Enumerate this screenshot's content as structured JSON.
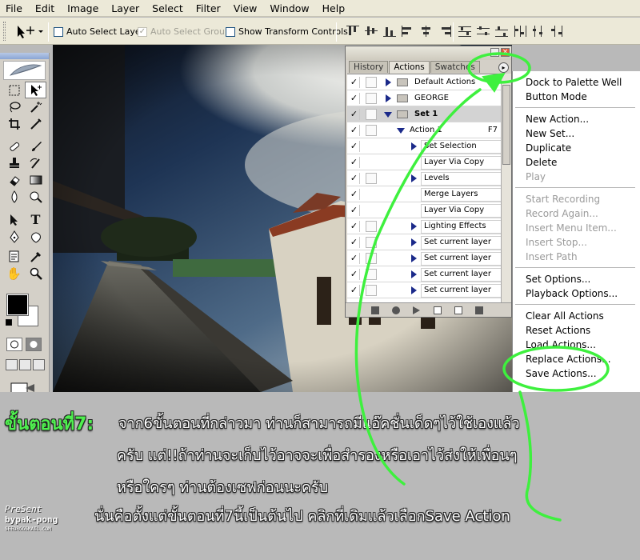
{
  "menubar": [
    "File",
    "Edit",
    "Image",
    "Layer",
    "Select",
    "Filter",
    "View",
    "Window",
    "Help"
  ],
  "options": {
    "auto_select_layer": "Auto Select Layer",
    "auto_select_groups": "Auto Select Groups",
    "show_transform_controls": "Show Transform Controls"
  },
  "palette": {
    "tabs": [
      "History",
      "Actions",
      "Swatches"
    ],
    "active_tab": "Actions",
    "rows": [
      {
        "label": "Default Actions",
        "kind": "set"
      },
      {
        "label": "GEORGE",
        "kind": "set"
      },
      {
        "label": "Set 1",
        "kind": "set-open"
      },
      {
        "label": "Action 1",
        "kind": "action",
        "key": "F7"
      },
      {
        "label": "Set Selection",
        "kind": "cmd"
      },
      {
        "label": "Layer Via Copy",
        "kind": "cmd"
      },
      {
        "label": "Levels",
        "kind": "cmd"
      },
      {
        "label": "Merge Layers",
        "kind": "cmd"
      },
      {
        "label": "Layer Via Copy",
        "kind": "cmd"
      },
      {
        "label": "Lighting Effects",
        "kind": "cmd"
      },
      {
        "label": "Set current layer",
        "kind": "cmd"
      },
      {
        "label": "Set current layer",
        "kind": "cmd"
      },
      {
        "label": "Set current layer",
        "kind": "cmd"
      },
      {
        "label": "Set current layer",
        "kind": "cmd"
      }
    ]
  },
  "flyout": {
    "items": [
      {
        "label": "Dock to Palette Well",
        "enabled": true
      },
      {
        "label": "Button Mode",
        "enabled": true
      },
      {
        "label": "New Action...",
        "enabled": true
      },
      {
        "label": "New Set...",
        "enabled": true
      },
      {
        "label": "Duplicate",
        "enabled": true
      },
      {
        "label": "Delete",
        "enabled": true
      },
      {
        "label": "Play",
        "enabled": false
      },
      {
        "label": "Start Recording",
        "enabled": false
      },
      {
        "label": "Record Again...",
        "enabled": false
      },
      {
        "label": "Insert Menu Item...",
        "enabled": false
      },
      {
        "label": "Insert Stop...",
        "enabled": false
      },
      {
        "label": "Insert Path",
        "enabled": false
      },
      {
        "label": "Set Options...",
        "enabled": true
      },
      {
        "label": "Playback Options...",
        "enabled": true
      },
      {
        "label": "Clear All Actions",
        "enabled": true
      },
      {
        "label": "Reset Actions",
        "enabled": true
      },
      {
        "label": "Load Actions...",
        "enabled": true
      },
      {
        "label": "Replace Actions...",
        "enabled": true
      },
      {
        "label": "Save Actions...",
        "enabled": true
      }
    ]
  },
  "caption": {
    "step": "ขั้นตอนที่7:",
    "line1": "จาก6ขั้นตอนที่กล่าวมา ท่านก็สามารถมีแอ๊คชั่นเด็ดๆไว้ใช้เองแล้ว",
    "line2": "ครับ แต่!!ถ้าท่านจะเก็บไว้อาจจะเพื่อสำรองหรือเอาไว้ส่งให้เพื่อนๆ",
    "line3": "หรือใครๆ ท่านต้องเซฟก่อนนะครับ",
    "line4": "นั่นคือตั้งแต่ขั้นตอนที่7นี้เป็นต้นไป คลิกที่เดิมแล้วเลือกSave Action"
  },
  "credit": {
    "present": "PreSent",
    "by": "bypak-pong",
    "email": "SEEDRGGSMAIL.COM"
  },
  "colors": {
    "annotation": "#3ef03e",
    "caption_step": "#4ff04f"
  }
}
